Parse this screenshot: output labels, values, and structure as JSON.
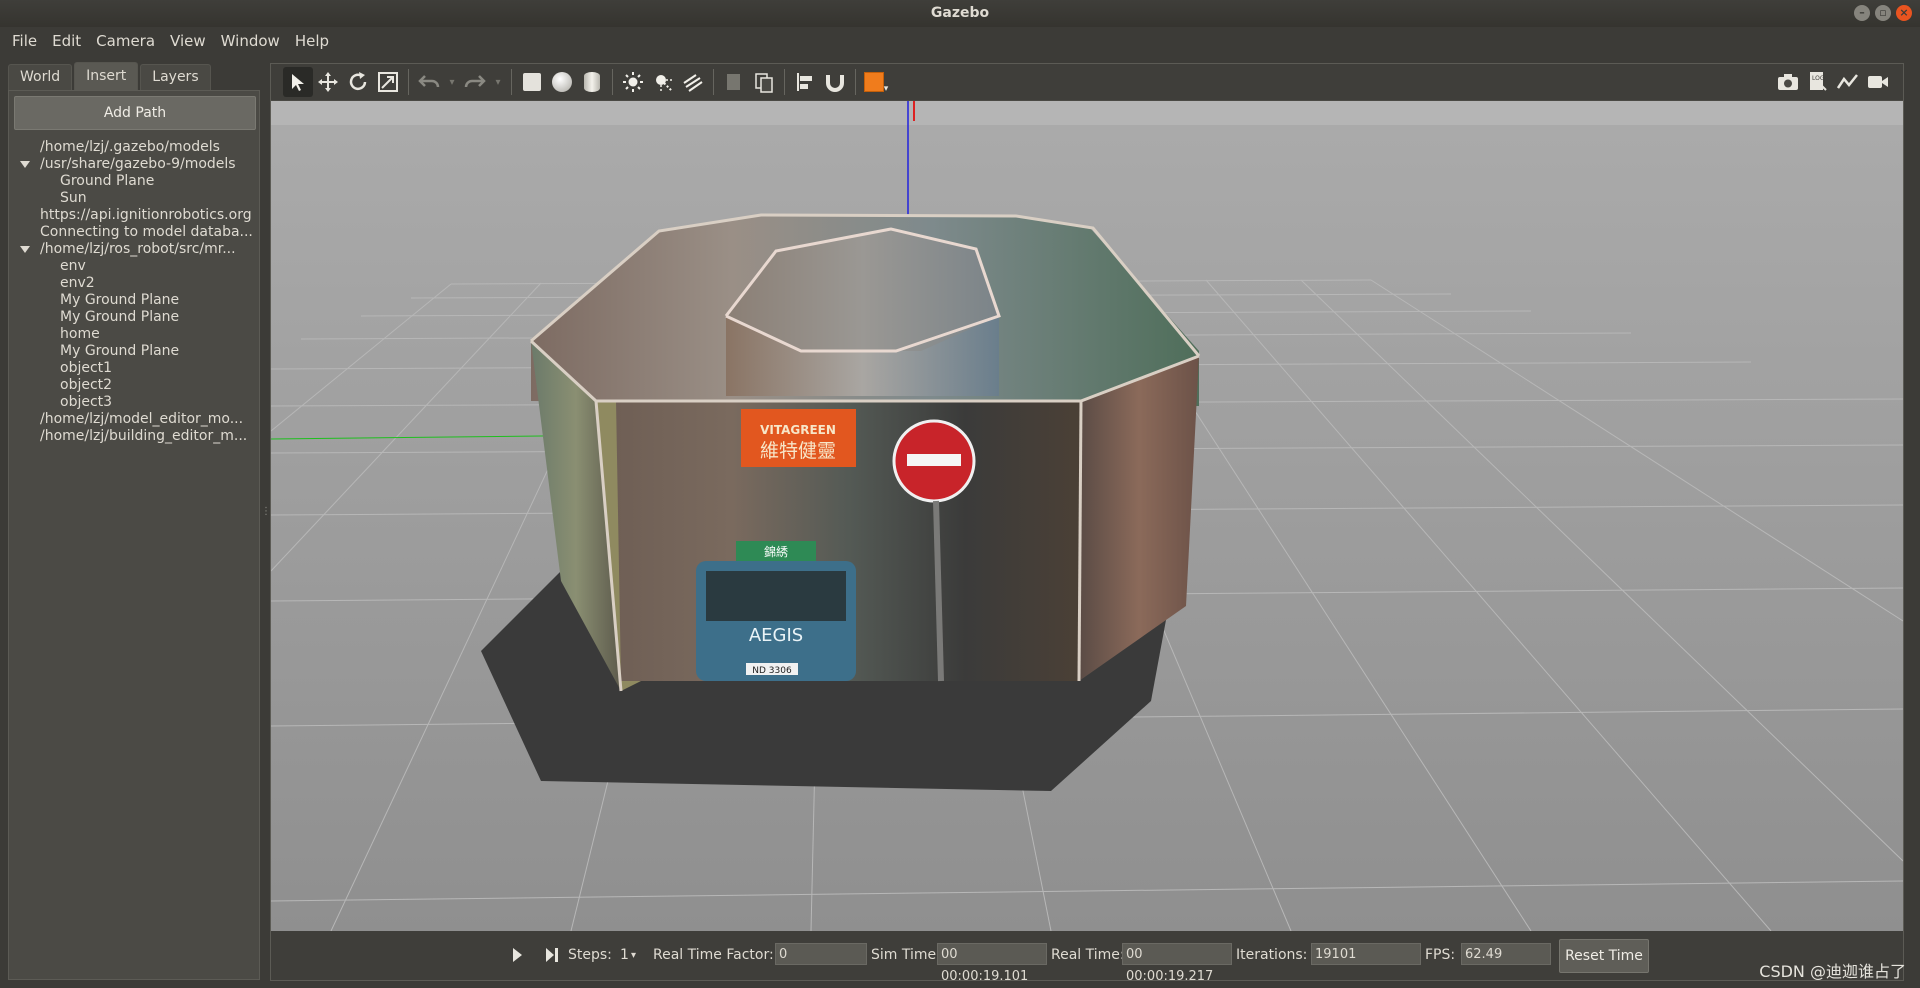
{
  "window": {
    "title": "Gazebo"
  },
  "menu": [
    "File",
    "Edit",
    "Camera",
    "View",
    "Window",
    "Help"
  ],
  "tabs": [
    "World",
    "Insert",
    "Layers"
  ],
  "insert": {
    "add_path_label": "Add Path",
    "tree": [
      {
        "label": "/home/lzj/.gazebo/models",
        "level": 0,
        "expanded": false
      },
      {
        "label": "/usr/share/gazebo-9/models",
        "level": 0,
        "expanded": true
      },
      {
        "label": "Ground Plane",
        "level": 1
      },
      {
        "label": "Sun",
        "level": 1
      },
      {
        "label": "https://api.ignitionrobotics.org",
        "level": 0,
        "expanded": false
      },
      {
        "label": "Connecting to model databa...",
        "level": 0,
        "expanded": false
      },
      {
        "label": "/home/lzj/ros_robot/src/mr...",
        "level": 0,
        "expanded": true
      },
      {
        "label": "env",
        "level": 1
      },
      {
        "label": "env2",
        "level": 1
      },
      {
        "label": "My Ground Plane",
        "level": 1
      },
      {
        "label": "My Ground Plane",
        "level": 1
      },
      {
        "label": "home",
        "level": 1
      },
      {
        "label": "My Ground Plane",
        "level": 1
      },
      {
        "label": "object1",
        "level": 1
      },
      {
        "label": "object2",
        "level": 1
      },
      {
        "label": "object3",
        "level": 1
      },
      {
        "label": "/home/lzj/model_editor_mo...",
        "level": 0,
        "expanded": false
      },
      {
        "label": "/home/lzj/building_editor_m...",
        "level": 0,
        "expanded": false
      }
    ]
  },
  "scene": {
    "billboard_text": "VITAGREEN",
    "billboard_cn": "維特健靈",
    "bus_brand": "AEGIS",
    "bus_sign": "錦綉",
    "plate": "ND 3306"
  },
  "status": {
    "steps_label": "Steps:",
    "steps_value": "1",
    "rtf_label": "Real Time Factor:",
    "rtf_value": "0",
    "sim_time_label": "Sim Time:",
    "sim_time_value": "00 00:00:19.101",
    "real_time_label": "Real Time:",
    "real_time_value": "00 00:00:19.217",
    "iterations_label": "Iterations:",
    "iterations_value": "19101",
    "fps_label": "FPS:",
    "fps_value": "62.49",
    "reset_label": "Reset Time"
  },
  "watermark": "CSDN @迪迦谁占了"
}
